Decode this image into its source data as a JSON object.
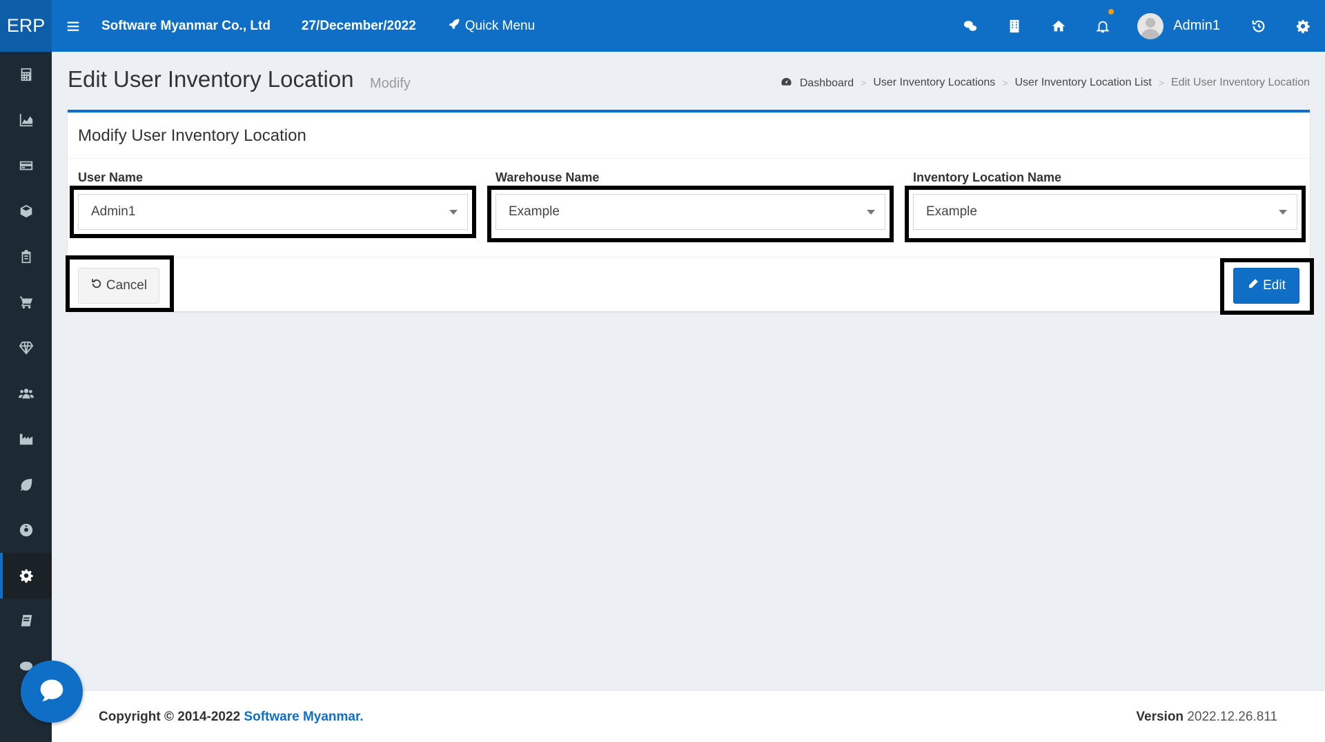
{
  "header": {
    "logo": "ERP",
    "company": "Software Myanmar Co., Ltd",
    "date": "27/December/2022",
    "quick_menu": "Quick Menu",
    "username": "Admin1"
  },
  "sidebar": {
    "items": [
      "calculator-icon",
      "area-chart-icon",
      "credit-card-icon",
      "cube-icon",
      "clipboard-icon",
      "cart-icon",
      "diamond-icon",
      "users-icon",
      "factory-icon",
      "leaf-icon",
      "soccer-ball-icon",
      "gear-icon",
      "book-icon",
      "comment-icon"
    ],
    "active": "gear-icon"
  },
  "page": {
    "title": "Edit User Inventory Location",
    "subtitle": "Modify"
  },
  "breadcrumb": {
    "items": [
      "Dashboard",
      "User Inventory Locations",
      "User Inventory Location List",
      "Edit User Inventory Location"
    ]
  },
  "form": {
    "title": "Modify User Inventory Location",
    "user_name_label": "User Name",
    "user_name_value": "Admin1",
    "warehouse_label": "Warehouse Name",
    "warehouse_value": "Example",
    "location_label": "Inventory Location Name",
    "location_value": "Example",
    "cancel_label": "Cancel",
    "edit_label": "Edit"
  },
  "footer": {
    "copyright_prefix": "Copyright © 2014-2022",
    "brand": "Software Myanmar.",
    "version_label": "Version",
    "version_value": "2022.12.26.811"
  },
  "colors": {
    "primary": "#0f6fc6",
    "sidebar": "#1e2a33",
    "background": "#ecf0f5"
  }
}
